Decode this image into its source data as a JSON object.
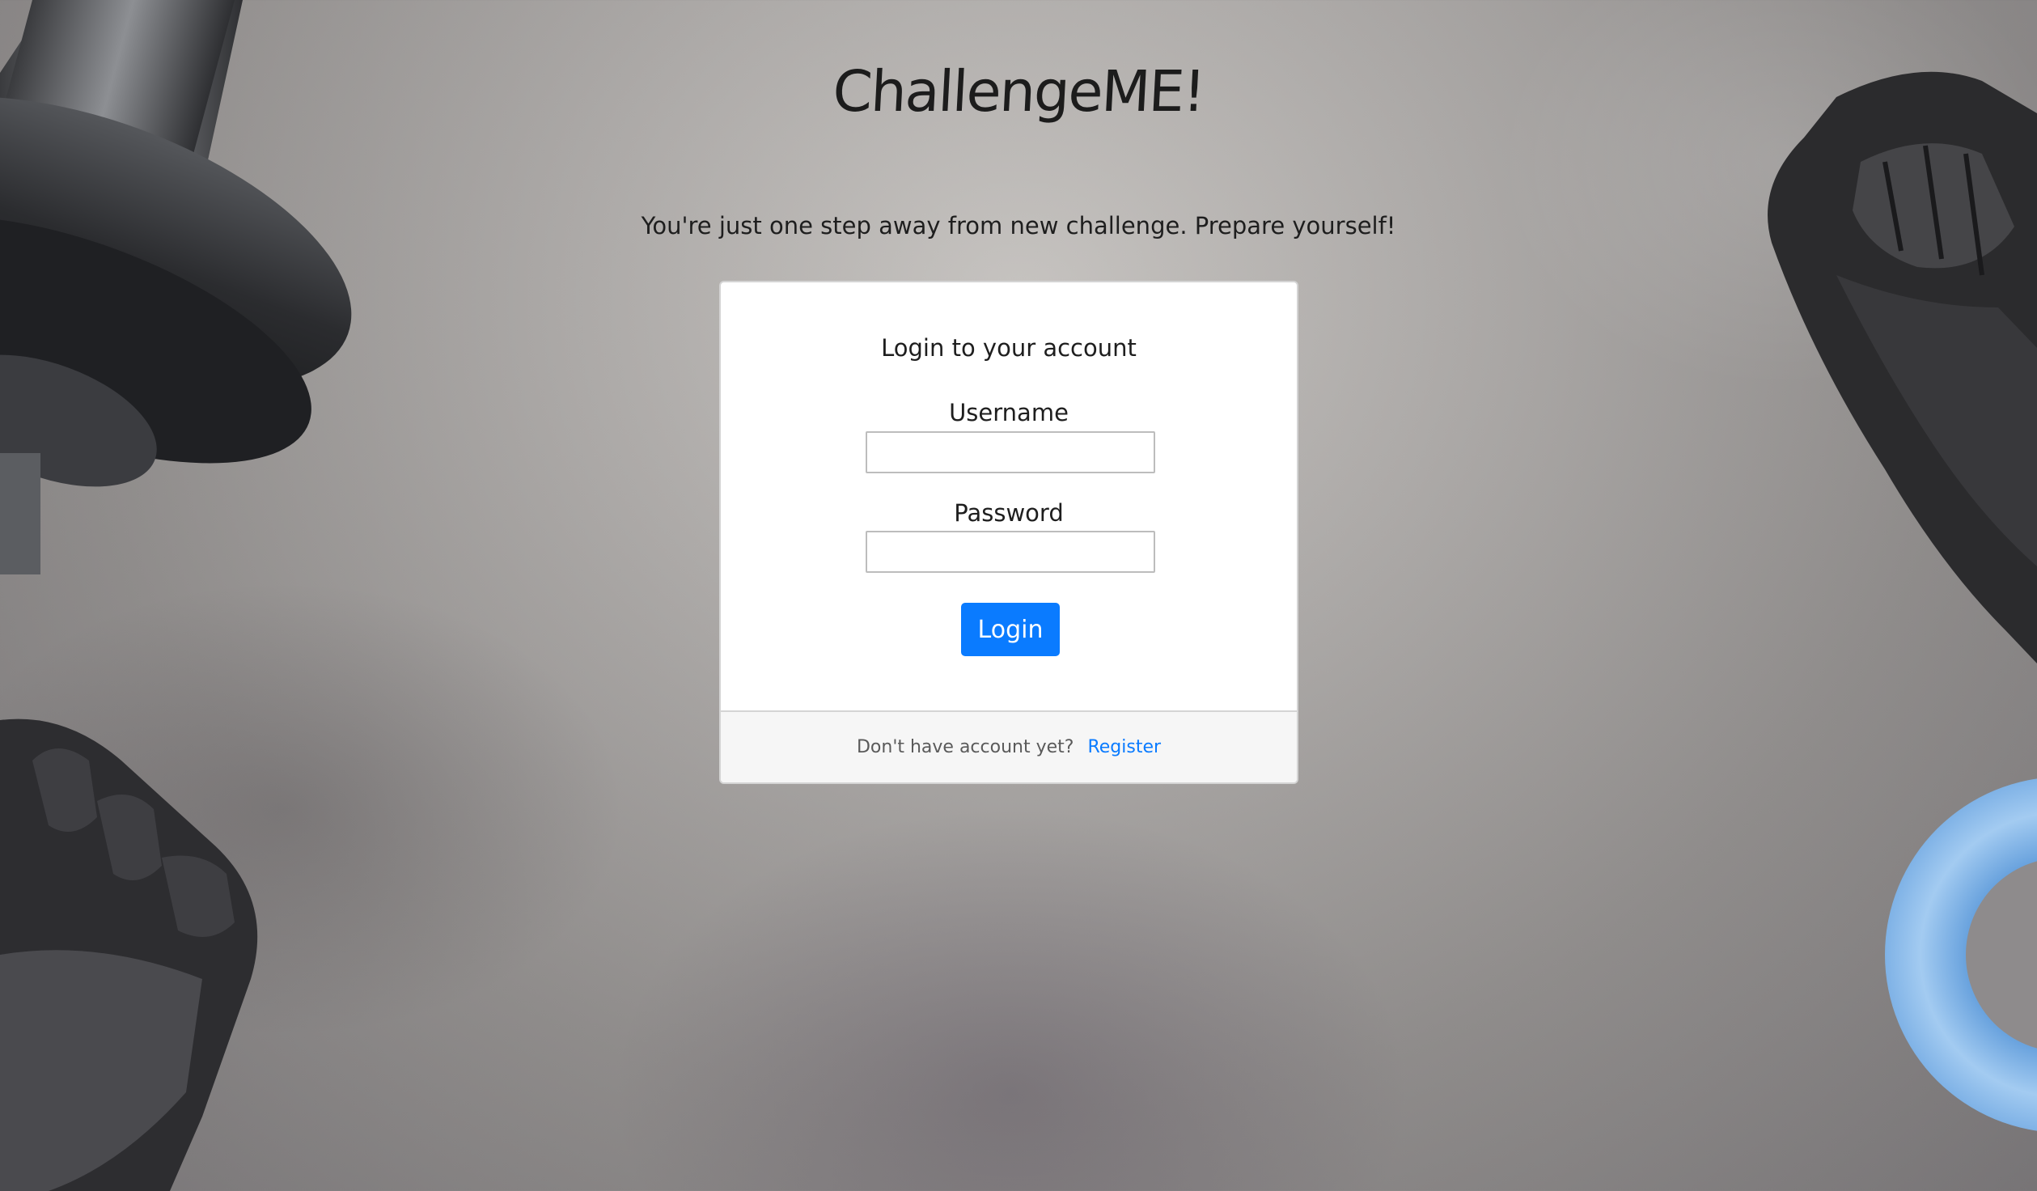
{
  "logo": {
    "text": "ChallengeME!"
  },
  "tagline": "You're just one step away from new challenge. Prepare yourself!",
  "login_card": {
    "title": "Login to your account",
    "username_label": "Username",
    "username_value": "",
    "password_label": "Password",
    "password_value": "",
    "login_button": "Login",
    "footer_text": "Don't have account yet?",
    "register_link": "Register"
  },
  "colors": {
    "accent": "#0a7bff",
    "card_bg": "#ffffff",
    "footer_bg": "#f6f6f6",
    "background": "#adaaa8"
  },
  "decorations": [
    "dumbbell-image",
    "glove-image",
    "glove-image",
    "grip-ring-image"
  ]
}
